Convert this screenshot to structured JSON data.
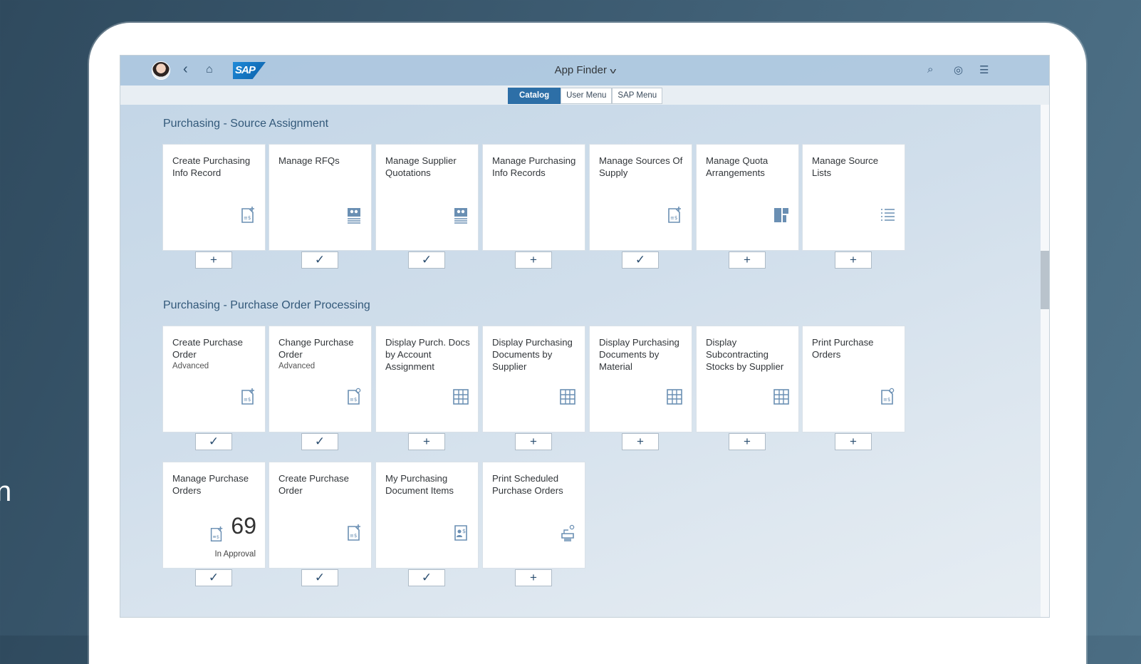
{
  "shell": {
    "app_title": "App Finder",
    "tabs": [
      "Catalog",
      "User Menu",
      "SAP Menu"
    ],
    "active_tab": "Catalog",
    "logo_text": "SAP"
  },
  "groups": [
    {
      "title": "Purchasing - Source Assignment",
      "tiles": [
        {
          "title": "Create Purchasing Info Record",
          "subtitle": "",
          "icon": "document-add-icon",
          "state": "+"
        },
        {
          "title": "Manage RFQs",
          "subtitle": "",
          "icon": "contacts-list-icon",
          "state": "✓"
        },
        {
          "title": "Manage Supplier Quotations",
          "subtitle": "",
          "icon": "contacts-list-icon",
          "state": "✓"
        },
        {
          "title": "Manage Purchasing Info Records",
          "subtitle": "",
          "icon": "",
          "state": "+"
        },
        {
          "title": "Manage Sources Of Supply",
          "subtitle": "",
          "icon": "document-add-icon",
          "state": "✓"
        },
        {
          "title": "Manage Quota Arrangements",
          "subtitle": "",
          "icon": "quota-blocks-icon",
          "state": "+"
        },
        {
          "title": "Manage Source Lists",
          "subtitle": "",
          "icon": "list-icon",
          "state": "+"
        }
      ]
    },
    {
      "title": "Purchasing - Purchase Order Processing",
      "tiles": [
        {
          "title": "Create Purchase Order",
          "subtitle": "Advanced",
          "icon": "document-add-icon",
          "state": "✓"
        },
        {
          "title": "Change Purchase Order",
          "subtitle": "Advanced",
          "icon": "document-search-icon",
          "state": "✓"
        },
        {
          "title": "Display Purch. Docs by Account Assignment",
          "subtitle": "",
          "icon": "table-icon",
          "state": "+"
        },
        {
          "title": "Display Purchasing Documents by Supplier",
          "subtitle": "",
          "icon": "table-icon",
          "state": "+"
        },
        {
          "title": "Display Purchasing Documents by Material",
          "subtitle": "",
          "icon": "table-icon",
          "state": "+"
        },
        {
          "title": "Display Subcontracting Stocks by Supplier",
          "subtitle": "",
          "icon": "table-icon",
          "state": "+"
        },
        {
          "title": "Print Purchase Orders",
          "subtitle": "",
          "icon": "document-search-icon",
          "state": "+"
        },
        {
          "title": "Manage Purchase Orders",
          "subtitle": "",
          "icon": "document-add-icon",
          "state": "✓",
          "kpi": "69",
          "kpi_label": "In Approval"
        },
        {
          "title": "Create Purchase Order",
          "subtitle": "",
          "icon": "document-add-icon",
          "state": "✓"
        },
        {
          "title": "My Purchasing Document Items",
          "subtitle": "",
          "icon": "contact-document-icon",
          "state": "✓"
        },
        {
          "title": "Print Scheduled Purchase Orders",
          "subtitle": "",
          "icon": "print-search-icon",
          "state": "+"
        }
      ]
    }
  ]
}
